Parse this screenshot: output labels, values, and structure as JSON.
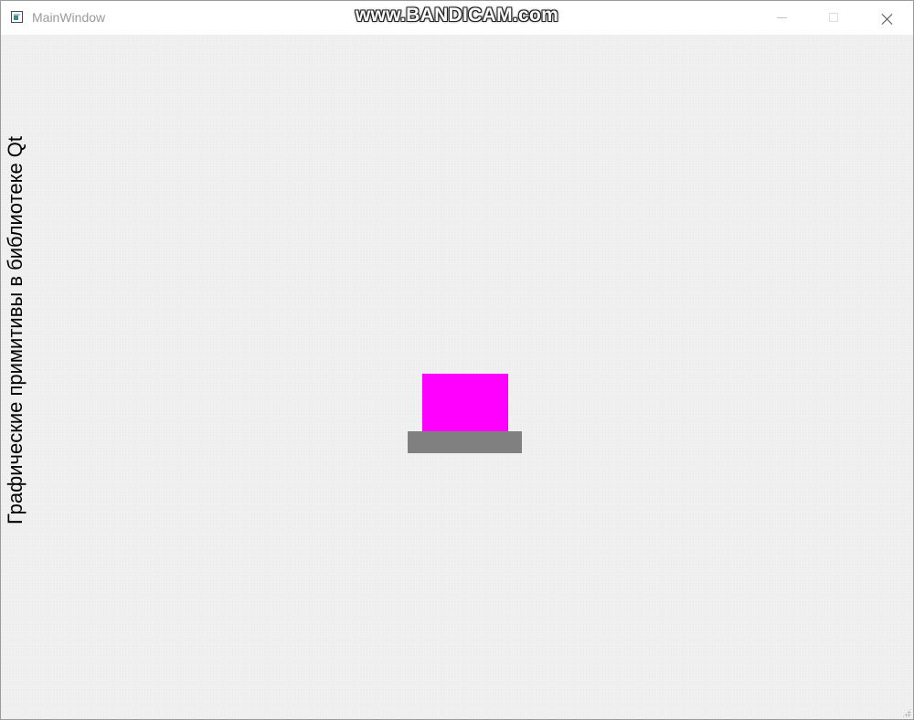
{
  "window": {
    "title": "MainWindow",
    "watermark": "www.BANDICAM.com"
  },
  "canvas": {
    "vertical_text": "Графические примитивы в библиотеке Qt",
    "shapes": [
      {
        "name": "magenta-rectangle",
        "color": "#ff00ff"
      },
      {
        "name": "gray-rectangle",
        "color": "#808080"
      }
    ]
  },
  "icons": {
    "app": "app-window-icon",
    "minimize": "minimize-icon",
    "maximize": "maximize-icon",
    "close": "close-icon",
    "resize": "size-grip-icon"
  }
}
